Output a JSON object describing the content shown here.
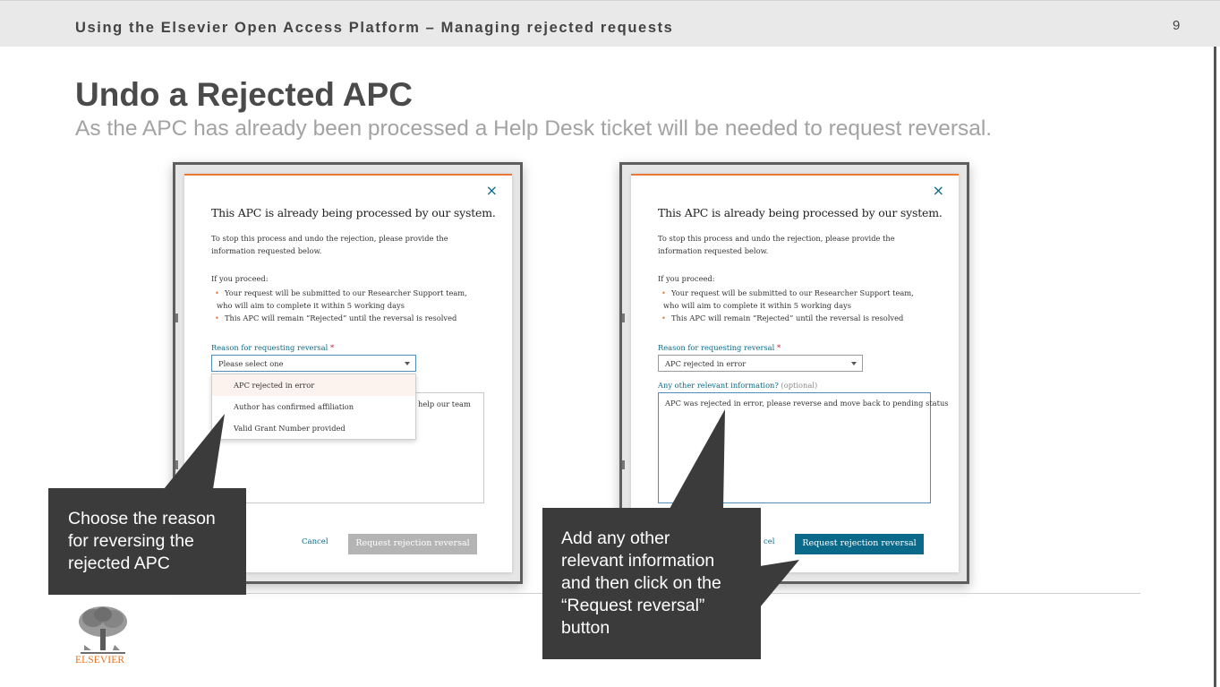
{
  "header": {
    "title": "Using the Elsevier Open Access Platform – Managing rejected requests",
    "page_number": "9"
  },
  "slide": {
    "title": "Undo a Rejected APC",
    "subtitle": "As the APC has already been processed a Help Desk ticket will be needed to request reversal."
  },
  "dialog_common": {
    "close_icon": "×",
    "heading": "This APC is already being processed by our system.",
    "intro": "To stop this process and undo the rejection, please provide the information requested below.",
    "proceed_label": "If you proceed:",
    "bullets": [
      "Your request will be submitted to our Researcher Support team, who will aim to complete it within 5 working days",
      "This APC will remain “Rejected” until the reversal is resolved"
    ],
    "reason_label": "Reason for requesting reversal",
    "required_mark": "*",
    "cancel_label": "Cancel",
    "submit_label": "Request rejection reversal"
  },
  "left_dialog": {
    "select_value": "Please select one",
    "options": [
      "APC rejected in error",
      "Author has confirmed affiliation",
      "Valid Grant Number provided"
    ],
    "hovered_option_index": 0,
    "textarea_partial_text": "help our team",
    "submit_state": "disabled"
  },
  "right_dialog": {
    "select_value": "APC rejected in error",
    "other_label": "Any other relevant information?",
    "other_optional": "(optional)",
    "textarea_value": "APC was rejected in error, please reverse and move back to pending status",
    "cancel_partial": "cel",
    "submit_state": "enabled"
  },
  "callouts": {
    "left": [
      "Choose the reason",
      "for reversing the",
      "rejected APC"
    ],
    "right": [
      "Add any other",
      "relevant information",
      "and then click on the",
      "“Request reversal”",
      "button"
    ]
  },
  "footer": {
    "logo_icon": "elsevier-tree-logo",
    "logo_text": "ELSEVIER"
  },
  "colors": {
    "header_bar": "#e9e9e9",
    "callout_bg": "#3b3b3b",
    "accent_teal": "#0b6a8a",
    "accent_orange": "#e87a38",
    "disabled_button": "#b4b4b4",
    "subtitle_gray": "#a3a3a3"
  }
}
